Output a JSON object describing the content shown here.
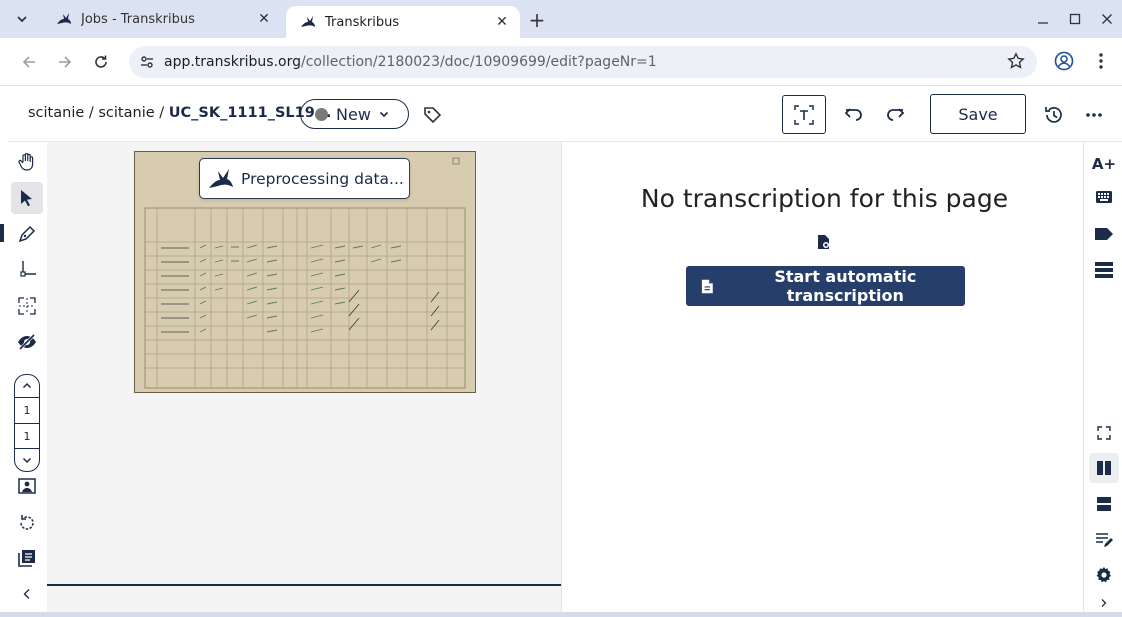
{
  "browser": {
    "tabs": [
      {
        "title": "Jobs - Transkribus",
        "active": false
      },
      {
        "title": "Transkribus",
        "active": true
      }
    ],
    "url_host": "app.transkribus.org",
    "url_path": "/collection/2180023/doc/10909699/edit?pageNr=1"
  },
  "header": {
    "breadcrumb": {
      "part1": "scitanie",
      "sep": " / ",
      "part2": "scitanie",
      "current": "UC_SK_1111_SL19..."
    },
    "status_label": "New",
    "save_label": "Save"
  },
  "canvas": {
    "preprocessing_label": "Preprocessing data..."
  },
  "page_nav": {
    "current_page": "1",
    "total_pages": "1"
  },
  "transcription": {
    "empty_title": "No transcription for this page",
    "start_button_label": "Start automatic transcription"
  },
  "right_toolbar": {
    "font_size_label": "A+"
  },
  "colors": {
    "primary": "#1b2b48",
    "button_fill": "#263f6a",
    "tabbar": "#dbe3f3",
    "canvas_bg": "#f4f4f4"
  }
}
